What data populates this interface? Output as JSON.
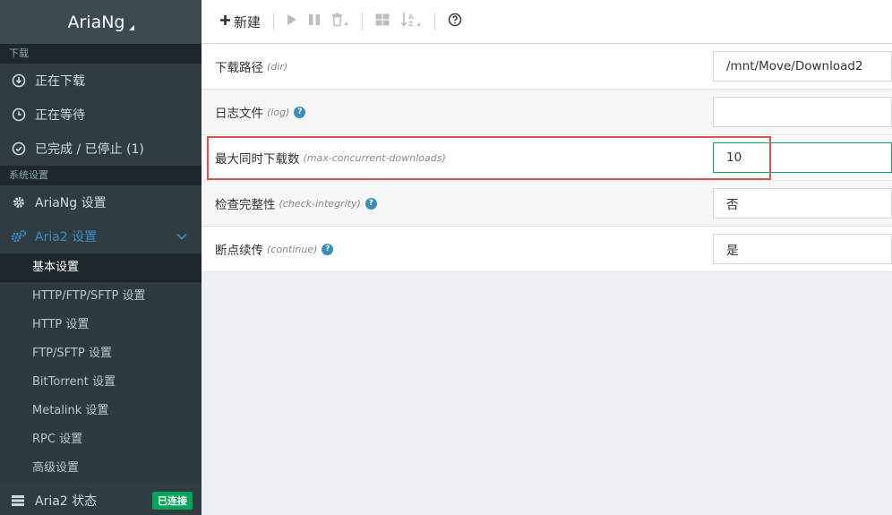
{
  "brand": "AriaNg",
  "sidebar": {
    "section_downloads": "下载",
    "downloading": "正在下载",
    "waiting": "正在等待",
    "stopped": "已完成 / 已停止 (1)",
    "section_settings": "系统设置",
    "ariang_settings": "AriaNg 设置",
    "aria2_settings": "Aria2 设置",
    "sub_items": [
      "基本设置",
      "HTTP/FTP/SFTP 设置",
      "HTTP 设置",
      "FTP/SFTP 设置",
      "BitTorrent 设置",
      "Metalink 设置",
      "RPC 设置",
      "高级设置"
    ],
    "aria2_status": "Aria2 状态",
    "connected_badge": "已连接"
  },
  "toolbar": {
    "new_label": "新建"
  },
  "settings": [
    {
      "label": "下载路径",
      "option": "(dir)",
      "value": "/mnt/Move/Download2",
      "help": false
    },
    {
      "label": "日志文件",
      "option": "(log)",
      "value": "",
      "help": true
    },
    {
      "label": "最大同时下载数",
      "option": "(max-concurrent-downloads)",
      "value": "10",
      "help": false
    },
    {
      "label": "检查完整性",
      "option": "(check-integrity)",
      "value": "否",
      "help": true
    },
    {
      "label": "断点续传",
      "option": "(continue)",
      "value": "是",
      "help": true
    }
  ],
  "colors": {
    "accent": "#3c8dbc",
    "badge": "#00a65a",
    "highlight": "#d9534f"
  }
}
